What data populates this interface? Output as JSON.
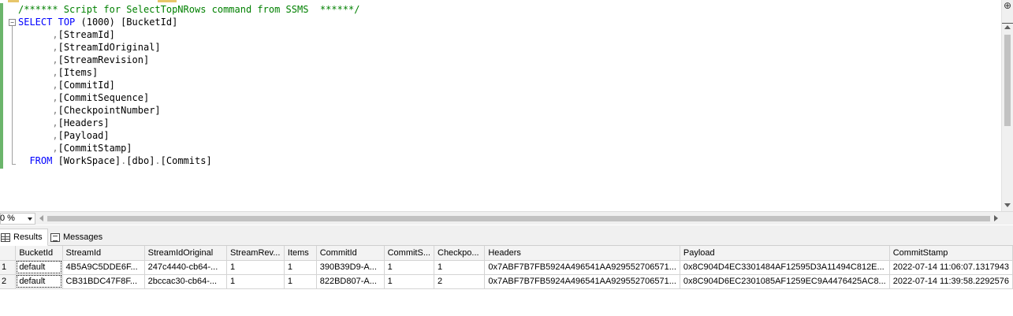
{
  "editor": {
    "lines": [
      [
        {
          "t": "/****** Script for SelectTopNRows command from SSMS  ******/",
          "c": "cm"
        }
      ],
      [
        {
          "t": "SELECT",
          "c": "kw"
        },
        {
          "t": " ",
          "c": "tx"
        },
        {
          "t": "TOP",
          "c": "kw"
        },
        {
          "t": " (1000) [BucketId]",
          "c": "tx"
        }
      ],
      [
        {
          "t": "      ",
          "c": "tx"
        },
        {
          "t": ",",
          "c": "op"
        },
        {
          "t": "[StreamId]",
          "c": "tx"
        }
      ],
      [
        {
          "t": "      ",
          "c": "tx"
        },
        {
          "t": ",",
          "c": "op"
        },
        {
          "t": "[StreamIdOriginal]",
          "c": "tx"
        }
      ],
      [
        {
          "t": "      ",
          "c": "tx"
        },
        {
          "t": ",",
          "c": "op"
        },
        {
          "t": "[StreamRevision]",
          "c": "tx"
        }
      ],
      [
        {
          "t": "      ",
          "c": "tx"
        },
        {
          "t": ",",
          "c": "op"
        },
        {
          "t": "[Items]",
          "c": "tx"
        }
      ],
      [
        {
          "t": "      ",
          "c": "tx"
        },
        {
          "t": ",",
          "c": "op"
        },
        {
          "t": "[CommitId]",
          "c": "tx"
        }
      ],
      [
        {
          "t": "      ",
          "c": "tx"
        },
        {
          "t": ",",
          "c": "op"
        },
        {
          "t": "[CommitSequence]",
          "c": "tx"
        }
      ],
      [
        {
          "t": "      ",
          "c": "tx"
        },
        {
          "t": ",",
          "c": "op"
        },
        {
          "t": "[CheckpointNumber]",
          "c": "tx"
        }
      ],
      [
        {
          "t": "      ",
          "c": "tx"
        },
        {
          "t": ",",
          "c": "op"
        },
        {
          "t": "[Headers]",
          "c": "tx"
        }
      ],
      [
        {
          "t": "      ",
          "c": "tx"
        },
        {
          "t": ",",
          "c": "op"
        },
        {
          "t": "[Payload]",
          "c": "tx"
        }
      ],
      [
        {
          "t": "      ",
          "c": "tx"
        },
        {
          "t": ",",
          "c": "op"
        },
        {
          "t": "[CommitStamp]",
          "c": "tx"
        }
      ],
      [
        {
          "t": "  ",
          "c": "tx"
        },
        {
          "t": "FROM",
          "c": "kw"
        },
        {
          "t": " [WorkSpace]",
          "c": "tx"
        },
        {
          "t": ".",
          "c": "op"
        },
        {
          "t": "[dbo]",
          "c": "tx"
        },
        {
          "t": ".",
          "c": "op"
        },
        {
          "t": "[Commits]",
          "c": "tx"
        }
      ]
    ],
    "collapse_glyph": "−",
    "splitter_glyph": "⊕"
  },
  "zoom": {
    "value": "0 %"
  },
  "tabs": [
    {
      "label": "Results",
      "icon": "grid-icon",
      "active": true
    },
    {
      "label": "Messages",
      "icon": "messages-icon",
      "active": false
    }
  ],
  "grid": {
    "columns": [
      "BucketId",
      "StreamId",
      "StreamIdOriginal",
      "StreamRev...",
      "Items",
      "CommitId",
      "CommitS...",
      "Checkpo...",
      "Headers",
      "Payload",
      "CommitStamp"
    ],
    "rows": [
      {
        "num": "1",
        "cells": [
          "default",
          "4B5A9C5DDE6F...",
          "247c4440-cb64-...",
          "1",
          "1",
          "390B39D9-A...",
          "1",
          "1",
          "0x7ABF7B7FB5924A496541AA929552706571...",
          "0x8C904D4EC3301484AF12595D3A11494C812E...",
          "2022-07-14 11:06:07.1317943"
        ]
      },
      {
        "num": "2",
        "cells": [
          "default",
          "CB31BDC47F8F...",
          "2bccac30-cb64-...",
          "1",
          "1",
          "822BD807-A...",
          "1",
          "2",
          "0x7ABF7B7FB5924A496541AA929552706571...",
          "0x8C904D6EC2301085AF1259EC9A4476425AC8...",
          "2022-07-14 11:39:58.2292576"
        ]
      }
    ]
  },
  "colors": {
    "keyword": "#0000ff",
    "comment": "#008000",
    "operator": "#808080",
    "change_bar": "#6bb56b"
  }
}
